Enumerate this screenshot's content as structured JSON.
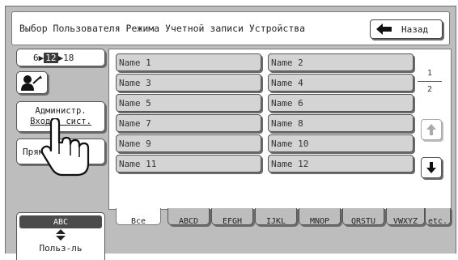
{
  "title": "Выбор Пользователя Режима Учетной записи Устройства",
  "back_button": {
    "label": "Назад"
  },
  "left_panel": {
    "pager": {
      "prev": "6",
      "current": "12",
      "next": "18"
    },
    "admin_login": {
      "line1": "Администр.",
      "line2": "Вход в сист."
    },
    "direct_login": {
      "label": "Прямой вход"
    },
    "abc_selector": {
      "top": "ABC",
      "bottom": "Польз-ль"
    }
  },
  "names": [
    "Name 1",
    "Name 2",
    "Name 3",
    "Name 4",
    "Name 5",
    "Name 6",
    "Name 7",
    "Name 8",
    "Name 9",
    "Name 10",
    "Name 11",
    "Name 12"
  ],
  "page_indicator": {
    "current": "1",
    "total": "2"
  },
  "tabs": [
    "Все",
    "ABCD",
    "EFGH",
    "IJKL",
    "MNOP",
    "QRSTU",
    "VWXYZ",
    "etc."
  ],
  "active_tab": "Все",
  "icons": {
    "back": "left-arrow-icon",
    "user": "user-key-icon",
    "scroll_up": "arrow-up-icon",
    "scroll_down": "arrow-down-icon",
    "cursor": "hand-pointer-icon"
  },
  "colors": {
    "panel_bg": "#bdbdbd",
    "name_button_bg": "#d4d4d4",
    "highlight": "#3a3a3a"
  }
}
